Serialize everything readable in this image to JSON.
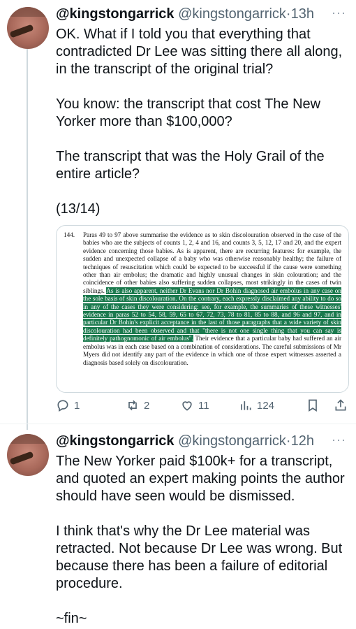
{
  "tweets": [
    {
      "name": "@kingstongarrick",
      "handle": "@kingstongarrick",
      "dot": "·",
      "time": "13h",
      "more": "···",
      "paragraphs": [
        "OK. What if I told you that everything that contradicted Dr Lee was sitting there all along, in the transcript of the original trial?",
        "You know: the transcript that cost The New Yorker more than $100,000?",
        "The transcript that was the Holy Grail of the entire article?",
        "(13/14)"
      ],
      "document": {
        "number": "144.",
        "text_before": "Paras 49 to 97 above summarise the evidence as to skin discolouration observed in the case of the babies who are the subjects of counts 1, 2, 4 and 16, and counts 3, 5, 12, 17 and 20, and the expert evidence concerning those babies. As is apparent, there are recurring features: for example, the sudden and unexpected collapse of a baby who was otherwise reasonably healthy; the failure of techniques of resuscitation which could be expected to be successful if the cause were something other than air embolus; the dramatic and highly unusual changes in skin colouration; and the coincidence of other babies also suffering sudden collapses, most strikingly in the cases of twin siblings.",
        "text_highlight": "As is also apparent, neither Dr Evans nor Dr Bohin diagnosed air embolus in any case on the sole basis of skin discolouration. On the contrary, each expressly disclaimed any ability to do so in any of the cases they were considering: see, for example, the summaries of these witnesses' evidence in paras 52 to 54, 58, 59, 65 to 67, 72, 73, 78 to 81, 85 to 88, and 96 and 97, and in particular Dr Bohin's explicit acceptance in the last of those paragraphs that a wide variety of skin discolouration had been observed and that \"there is not one single thing that you can say is definitely pathognomonic of air embolus\".",
        "text_after": "Their evidence that a particular baby had suffered an air embolus was in each case based on a combination of considerations. The careful submissions of Mr Myers did not identify any part of the evidence in which one of those expert witnesses asserted a diagnosis based solely on discolouration."
      },
      "actions": {
        "replies": "1",
        "retweets": "2",
        "likes": "11",
        "views": "124"
      }
    },
    {
      "name": "@kingstongarrick",
      "handle": "@kingstongarrick",
      "dot": "·",
      "time": "12h",
      "more": "···",
      "paragraphs": [
        "The New Yorker paid $100k+ for a transcript, and quoted an expert making points the author should have seen would be dismissed.",
        "I think that's why the Dr Lee material was retracted. Not because Dr Lee was wrong. But because there has been a failure of editorial procedure.",
        "~fin~"
      ]
    }
  ],
  "colors": {
    "highlight": "#1b7a4e",
    "text": "#0f1419",
    "secondary": "#536471",
    "border": "#cfd9de"
  }
}
